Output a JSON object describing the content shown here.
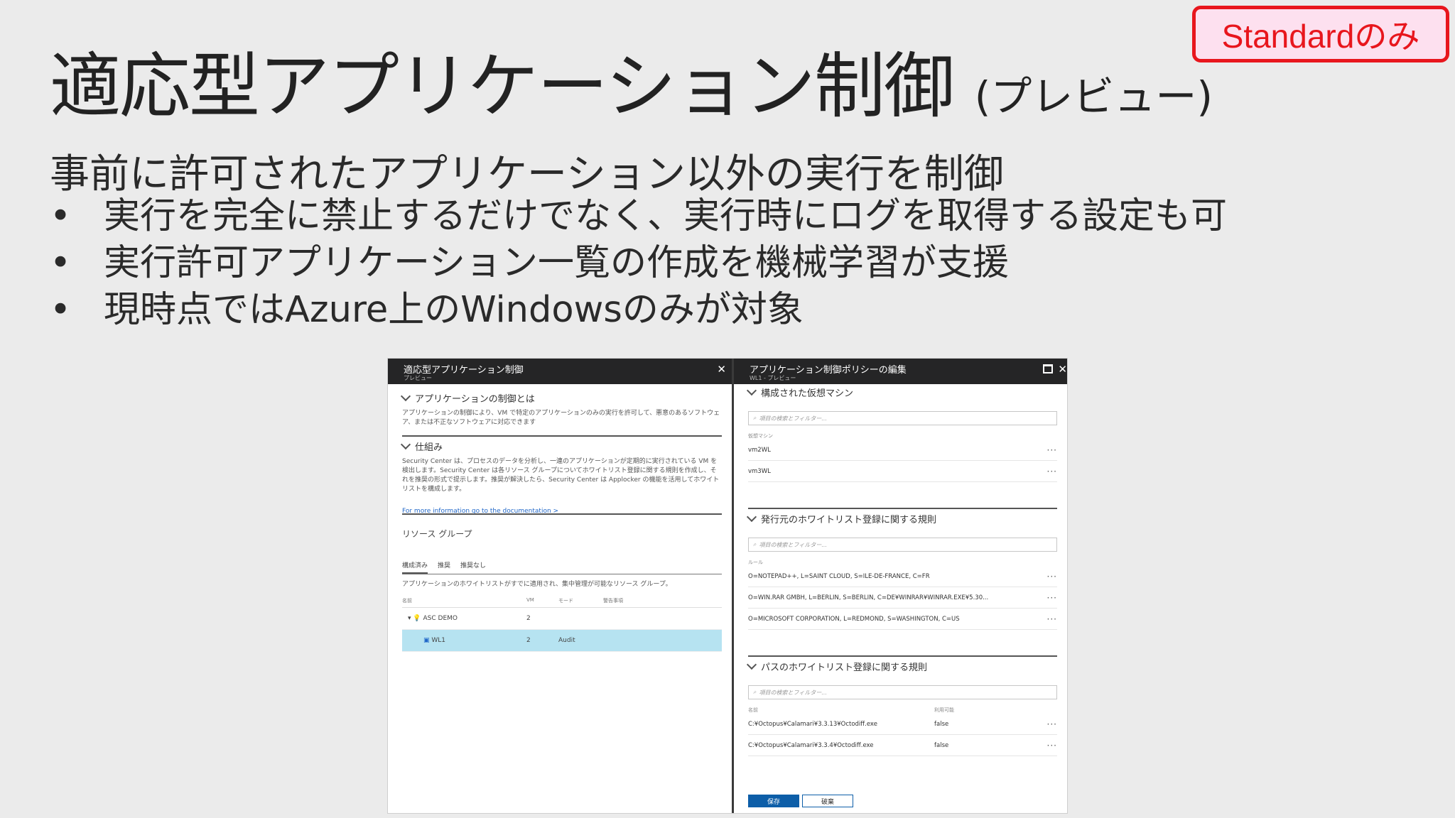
{
  "badge": "Standardのみ",
  "title": "適応型アプリケーション制御",
  "title_suffix": "(プレビュー)",
  "lead": "事前に許可されたアプリケーション以外の実行を制御",
  "bullets": [
    "実行を完全に禁止するだけでなく、実行時にログを取得する設定も可",
    "実行許可アプリケーション一覧の作成を機械学習が支援",
    "現時点ではAzure上のWindowsのみが対象"
  ],
  "left_pane": {
    "title": "適応型アプリケーション制御",
    "subtitle": "プレビュー",
    "section1": "アプリケーションの制御とは",
    "section1_text": "アプリケーションの制御により、VM で特定のアプリケーションのみの実行を許可して、悪意のあるソフトウェア、または不正なソフトウェアに対応できます",
    "section2": "仕組み",
    "section2_text": "Security Center は、プロセスのデータを分析し、一連のアプリケーションが定期的に実行されている VM を検出します。Security Center は各リソース グループについてホワイトリスト登録に関する規則を作成し、それを推奨の形式で提示します。推奨が解決したら、Security Center は Applocker の機能を活用してホワイトリストを構成します。",
    "doc_link": "For more information go to the documentation >",
    "resource_group": "リソース グループ",
    "tabs": [
      "構成済み",
      "推奨",
      "推奨なし"
    ],
    "tab_desc": "アプリケーションのホワイトリストがすでに適用され、集中管理が可能なリソース グループ。",
    "columns": [
      "名前",
      "VM",
      "モード",
      "警告事項"
    ],
    "rows": [
      {
        "name": "ASC DEMO",
        "vm": "2",
        "mode": ""
      },
      {
        "name": "WL1",
        "vm": "2",
        "mode": "Audit"
      }
    ]
  },
  "right_pane": {
    "title": "アプリケーション制御ポリシーの編集",
    "subtitle": "WL1 - プレビュー",
    "section_vm": "構成された仮想マシン",
    "search_placeholder": "項目の検索とフィルター...",
    "vm_col": "仮想マシン",
    "vms": [
      "vm2WL",
      "vm3WL"
    ],
    "section_publisher": "発行元のホワイトリスト登録に関する規則",
    "rule_col": "ルール",
    "rules": [
      "O=NOTEPAD++, L=SAINT CLOUD, S=ILE-DE-FRANCE, C=FR",
      "O=WIN.RAR GMBH, L=BERLIN, S=BERLIN, C=DE¥WINRAR¥WINRAR.EXE¥5.30...",
      "O=MICROSOFT CORPORATION, L=REDMOND, S=WASHINGTON, C=US"
    ],
    "section_path": "パスのホワイトリスト登録に関する規則",
    "path_cols": [
      "名前",
      "利用可能"
    ],
    "paths": [
      {
        "name": "C:¥Octopus¥Calamari¥3.3.13¥Octodiff.exe",
        "value": "false"
      },
      {
        "name": "C:¥Octopus¥Calamari¥3.3.4¥Octodiff.exe",
        "value": "false"
      }
    ],
    "save": "保存",
    "discard": "破棄"
  },
  "colors": {
    "badge_border": "#e8161d",
    "badge_bg": "#fde0ef",
    "selected_row": "#b6e3f1",
    "primary_button": "#0d5ea8"
  }
}
